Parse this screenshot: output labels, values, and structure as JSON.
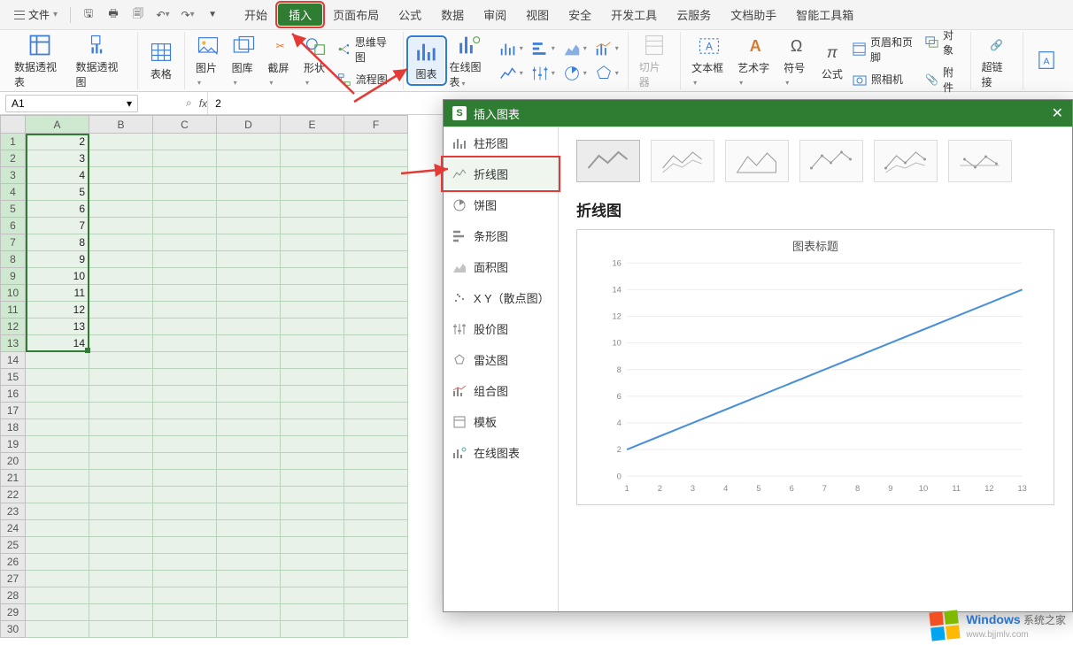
{
  "menubar": {
    "file_label": "文件",
    "tabs": [
      "开始",
      "插入",
      "页面布局",
      "公式",
      "数据",
      "审阅",
      "视图",
      "安全",
      "开发工具",
      "云服务",
      "文档助手",
      "智能工具箱"
    ],
    "active_tab_index": 1
  },
  "ribbon": {
    "pivot_table": "数据透视表",
    "pivot_chart": "数据透视图",
    "table": "表格",
    "picture": "图片",
    "gallery": "图库",
    "screenshot": "截屏",
    "shapes": "形状",
    "mindmap": "思维导图",
    "flowchart": "流程图",
    "chart": "图表",
    "online_chart": "在线图表",
    "slicer": "切片器",
    "textbox": "文本框",
    "wordart": "艺术字",
    "symbol": "符号",
    "equation": "公式",
    "header_footer": "页眉和页脚",
    "object": "对象",
    "camera": "照相机",
    "attachment": "附件",
    "hyperlink": "超链接"
  },
  "formula_bar": {
    "cell_ref": "A1",
    "value": "2"
  },
  "sheet": {
    "cols": [
      "A",
      "B",
      "C",
      "D",
      "E",
      "F"
    ],
    "row_count": 30,
    "data_col_A": [
      2,
      3,
      4,
      5,
      6,
      7,
      8,
      9,
      10,
      11,
      12,
      13,
      14
    ]
  },
  "dialog": {
    "title": "插入图表",
    "categories": [
      {
        "key": "column",
        "label": "柱形图"
      },
      {
        "key": "line",
        "label": "折线图"
      },
      {
        "key": "pie",
        "label": "饼图"
      },
      {
        "key": "bar",
        "label": "条形图"
      },
      {
        "key": "area",
        "label": "面积图"
      },
      {
        "key": "scatter",
        "label": "X Y（散点图）"
      },
      {
        "key": "stock",
        "label": "股价图"
      },
      {
        "key": "radar",
        "label": "雷达图"
      },
      {
        "key": "combo",
        "label": "组合图"
      },
      {
        "key": "template",
        "label": "模板"
      },
      {
        "key": "online",
        "label": "在线图表"
      }
    ],
    "selected_category_index": 1,
    "preview_heading": "折线图",
    "preview_chart_title": "图表标题"
  },
  "chart_data": {
    "type": "line",
    "title": "图表标题",
    "x": [
      1,
      2,
      3,
      4,
      5,
      6,
      7,
      8,
      9,
      10,
      11,
      12,
      13
    ],
    "values": [
      2,
      3,
      4,
      5,
      6,
      7,
      8,
      9,
      10,
      11,
      12,
      13,
      14
    ],
    "ylim": [
      0,
      16
    ],
    "ytick": [
      0,
      2,
      4,
      6,
      8,
      10,
      12,
      14,
      16
    ],
    "xlabel": "",
    "ylabel": ""
  },
  "watermark": {
    "brand": "Windows",
    "suffix": "系统之家",
    "url": "www.bjjmlv.com"
  }
}
